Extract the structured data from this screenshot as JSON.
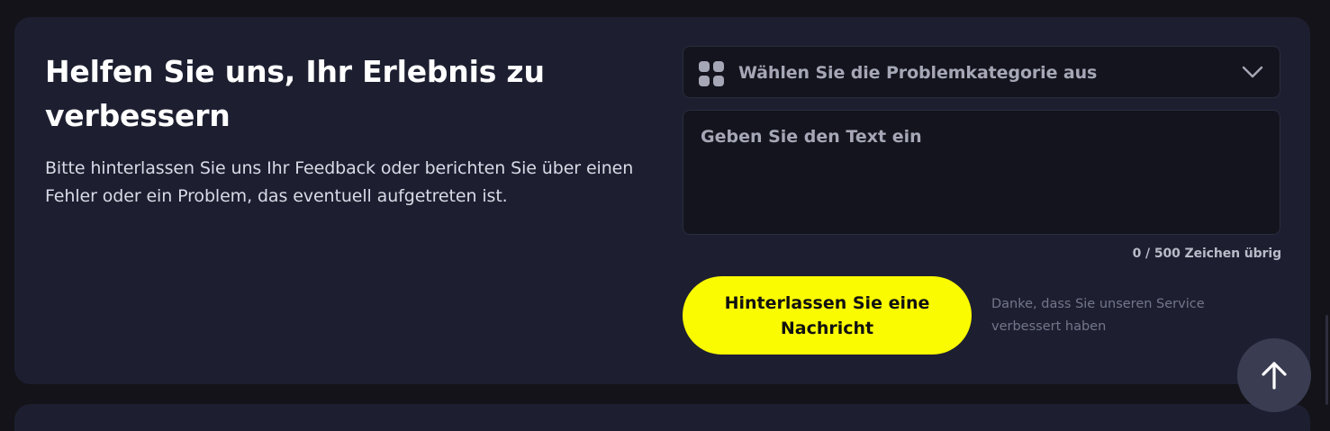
{
  "feedback": {
    "title": "Helfen Sie uns, Ihr Erlebnis zu verbessern",
    "description": "Bitte hinterlassen Sie uns Ihr Feedback oder berichten Sie über einen Fehler oder ein Problem, das eventuell aufgetreten ist.",
    "category_select": {
      "placeholder": "Wählen Sie die Problemkategorie aus",
      "icon": "grid-icon"
    },
    "text_input": {
      "value": "",
      "placeholder": "Geben Sie den Text ein"
    },
    "counter": "0 / 500 Zeichen übrig",
    "submit_label": "Hinterlassen Sie eine Nachricht",
    "thanks_text": "Danke, dass Sie unseren Service verbessert haben"
  },
  "scroll_top": {
    "icon": "arrow-up-icon"
  },
  "colors": {
    "page_bg": "#131319",
    "card_bg": "#1d1f31",
    "input_bg": "#13141d",
    "accent": "#fafa00",
    "muted_text": "#a5a7b6",
    "scroll_button_bg": "#3a3d52"
  }
}
